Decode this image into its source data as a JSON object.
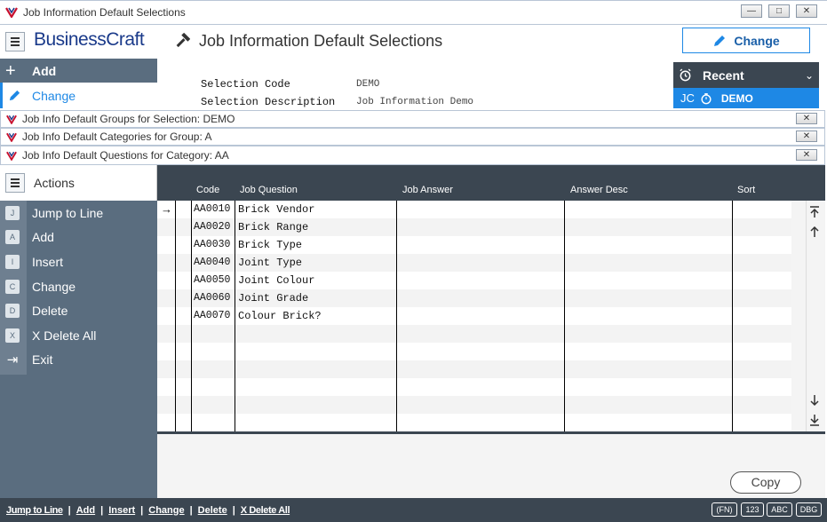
{
  "window": {
    "title": "Job Information Default Selections",
    "controls": [
      "—",
      "□",
      "✕"
    ]
  },
  "header": {
    "brand": "BusinessCraft",
    "page_title": "Job Information Default Selections",
    "change_button": "Change"
  },
  "topnav": {
    "add": "Add",
    "change": "Change"
  },
  "selection": {
    "code_label": "Selection Code",
    "code_value": "DEMO",
    "desc_label": "Selection Description",
    "desc_value": "Job Information Demo"
  },
  "recent": {
    "title": "Recent",
    "item_prefix": "JC",
    "item_label": "DEMO"
  },
  "subwindows": [
    {
      "title": "Job Info Default Groups for Selection: DEMO"
    },
    {
      "title": "Job Info Default Categories for Group: A"
    },
    {
      "title": "Job Info Default Questions for Category: AA"
    }
  ],
  "actions": {
    "header": "Actions",
    "items": [
      {
        "key": "J",
        "label": "Jump to Line"
      },
      {
        "key": "A",
        "label": "Add"
      },
      {
        "key": "I",
        "label": "Insert"
      },
      {
        "key": "C",
        "label": "Change"
      },
      {
        "key": "D",
        "label": "Delete"
      },
      {
        "key": "X",
        "label": "X Delete All"
      },
      {
        "key": "⇥",
        "label": "Exit"
      }
    ]
  },
  "table": {
    "columns": [
      "Code",
      "Job Question",
      "Job Answer",
      "Answer Desc",
      "Sort"
    ],
    "rows": [
      {
        "code": "AA0010",
        "question": "Brick Vendor"
      },
      {
        "code": "AA0020",
        "question": "Brick Range"
      },
      {
        "code": "AA0030",
        "question": "Brick Type"
      },
      {
        "code": "AA0040",
        "question": "Joint Type"
      },
      {
        "code": "AA0050",
        "question": "Joint Colour"
      },
      {
        "code": "AA0060",
        "question": "Joint Grade"
      },
      {
        "code": "AA0070",
        "question": "Colour Brick?"
      }
    ],
    "row_pointer": "→"
  },
  "copy_button": "Copy",
  "statusbar": {
    "items": [
      "Jump to Line",
      "Add",
      "Insert",
      "Change",
      "Delete",
      "X Delete All"
    ],
    "separator": "|",
    "badges": [
      "(FN)",
      "123",
      "ABC",
      "DBG"
    ]
  },
  "colors": {
    "brand_blue": "#1a3a8a",
    "brand_red": "#c8102e",
    "accent_blue": "#1e88e5",
    "nav_slate": "#5a6d7f",
    "header_dark": "#3b4651"
  }
}
